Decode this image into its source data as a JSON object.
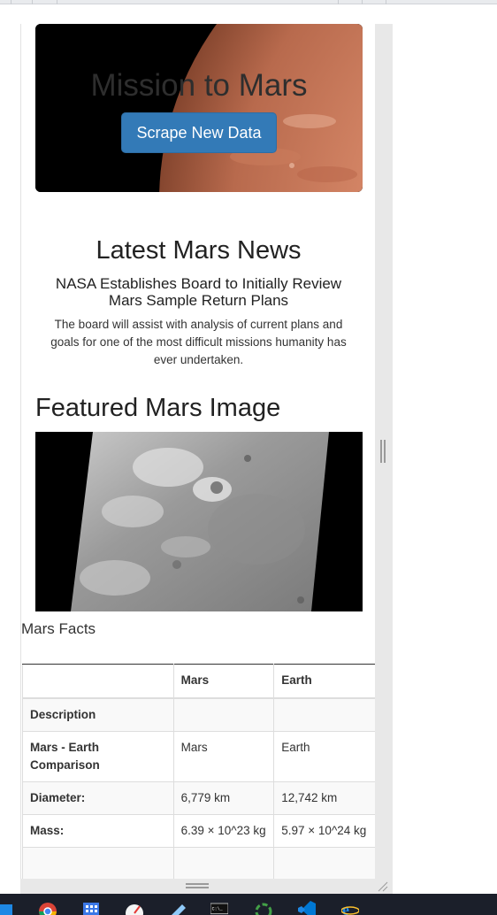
{
  "hero": {
    "title": "Mission to Mars",
    "button_label": "Scrape New Data"
  },
  "news": {
    "heading": "Latest Mars News",
    "title": "NASA Establishes Board to Initially Review Mars Sample Return Plans",
    "paragraph": "The board will assist with analysis of current plans and goals for one of the most difficult missions humanity has ever undertaken."
  },
  "featured": {
    "heading": "Featured Mars Image"
  },
  "facts": {
    "label": "Mars Facts",
    "columns": [
      "",
      "Mars",
      "Earth"
    ],
    "rows": [
      {
        "label": "Description",
        "mars": "",
        "earth": ""
      },
      {
        "label": "Mars - Earth Comparison",
        "mars": "Mars",
        "earth": "Earth"
      },
      {
        "label": "Diameter:",
        "mars": "6,779 km",
        "earth": "12,742 km"
      },
      {
        "label": "Mass:",
        "mars": "6.39 × 10^23 kg",
        "earth": "5.97 × 10^24 kg"
      }
    ]
  },
  "taskbar": {
    "icons": [
      "start-icon",
      "chrome-icon",
      "calculator-icon",
      "gauge-app-icon",
      "pen-app-icon",
      "terminal-icon",
      "refresh-app-icon",
      "vscode-icon",
      "internet-explorer-icon"
    ]
  },
  "colors": {
    "button_bg": "#337ab7",
    "taskbar_bg": "#1b1f2a"
  }
}
